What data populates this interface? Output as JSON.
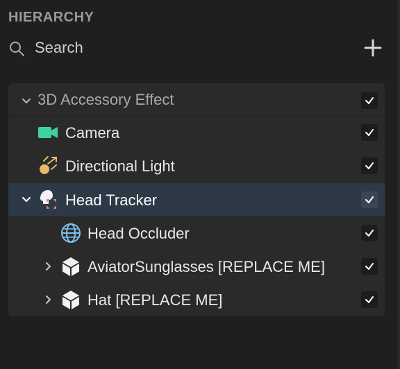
{
  "panel": {
    "title": "HIERARCHY",
    "search_placeholder": "Search"
  },
  "tree": [
    {
      "name": "root",
      "label": "3D Accessory Effect",
      "icon": "chevron-down",
      "expanded": true,
      "checked": true
    },
    {
      "name": "camera",
      "label": "Camera",
      "icon": "camera-icon",
      "checked": true
    },
    {
      "name": "directional-light",
      "label": "Directional Light",
      "icon": "light-icon",
      "checked": true
    },
    {
      "name": "head-tracker",
      "label": "Head Tracker",
      "icon": "head-tracker-icon",
      "expanded": true,
      "selected": true,
      "checked": true
    },
    {
      "name": "head-occluder",
      "label": "Head Occluder",
      "icon": "globe-icon",
      "checked": true
    },
    {
      "name": "aviator-sunglasses",
      "label": "AviatorSunglasses [REPLACE ME]",
      "icon": "cube-icon",
      "expanded": false,
      "checked": true
    },
    {
      "name": "hat",
      "label": "Hat [REPLACE ME]",
      "icon": "cube-icon",
      "expanded": false,
      "checked": true
    }
  ],
  "colors": {
    "background": "#1f1f1f",
    "tree_background": "#2a2a2a",
    "selected_row": "#2d3947",
    "camera_accent": "#3fd1a4",
    "light_accent": "#e8b96a",
    "globe_accent": "#7fc2f0",
    "tracker_accent": "#f0728a"
  }
}
